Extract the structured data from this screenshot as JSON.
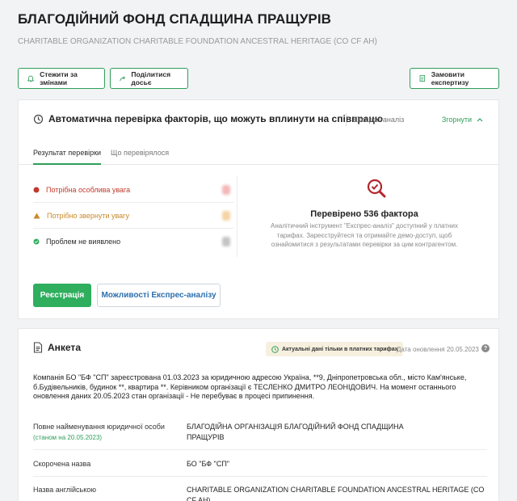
{
  "header": {
    "title": "БЛАГОДІЙНИЙ ФОНД СПАДЩИНА ПРАЩУРІВ",
    "subtitle": "CHARITABLE ORGANIZATION CHARITABLE FOUNDATION ANCESTRAL HERITAGE (CO CF AH)"
  },
  "actions": {
    "follow": "Стежити за змінами",
    "share": "Поділитися досьє",
    "order": "Замовити експертизу"
  },
  "check": {
    "title": "Автоматична перевірка факторів, що можуть вплинути на співпрацю",
    "mode": "Експрес-аналіз",
    "collapse": "Згорнути",
    "tabs": [
      "Результат перевірки",
      "Що перевірялося"
    ],
    "results": [
      {
        "label": "Потрібна особлива увага",
        "color": "#c0392b"
      },
      {
        "label": "Потрібно звернути увагу",
        "color": "#c8892a"
      },
      {
        "label": "Проблем не виявлено",
        "color": "#2b2b2b"
      }
    ],
    "verified": "Перевірено 536 фактора",
    "description": "Аналітичний інструмент \"Експрес-аналіз\" доступний у платних тарифах. Зареєструйтеся та отримайте демо-доступ, щоб ознайомитися з результатами перевірки за цим контрагентом.",
    "register": "Реєстрація",
    "capabilities": "Можливості Експрес-аналізу"
  },
  "anketa": {
    "title": "Анкета",
    "actual_badge": "Актуальні дані тільки в платних тарифах",
    "update_date": "Дата оновлення 20.05.2023",
    "about": "Компанія БО \"БФ \"СП\" зареєстрована 01.03.2023 за юридичною адресою Україна, **9, Дніпропетровська обл., місто Кам'янське, б.Будівельників, будинок **, квартира **. Керівником організації є ТЕСЛЕНКО ДМИТРО ЛЕОНІДОВИЧ. На момент останнього оновлення даних 20.05.2023 стан організації - Не перебуває в процесі припинення.",
    "fields": [
      {
        "label": "Повне найменування юридичної особи",
        "sub": "(станом на 20.05.2023)",
        "value": "БЛАГОДІЙНА ОРГАНІЗАЦІЯ БЛАГОДІЙНИЙ ФОНД СПАДЩИНА ПРАЩУРІВ"
      },
      {
        "label": "Скорочена назва",
        "value": "БО \"БФ \"СП\""
      },
      {
        "label": "Назва англійською",
        "value": "CHARITABLE ORGANIZATION CHARITABLE FOUNDATION ANCESTRAL HERITAGE (CO CF AH)"
      }
    ]
  },
  "colors": {
    "accent": "#2e9e5a",
    "link": "#2c6fae",
    "danger": "#c0392b",
    "warning": "#c8892a"
  }
}
